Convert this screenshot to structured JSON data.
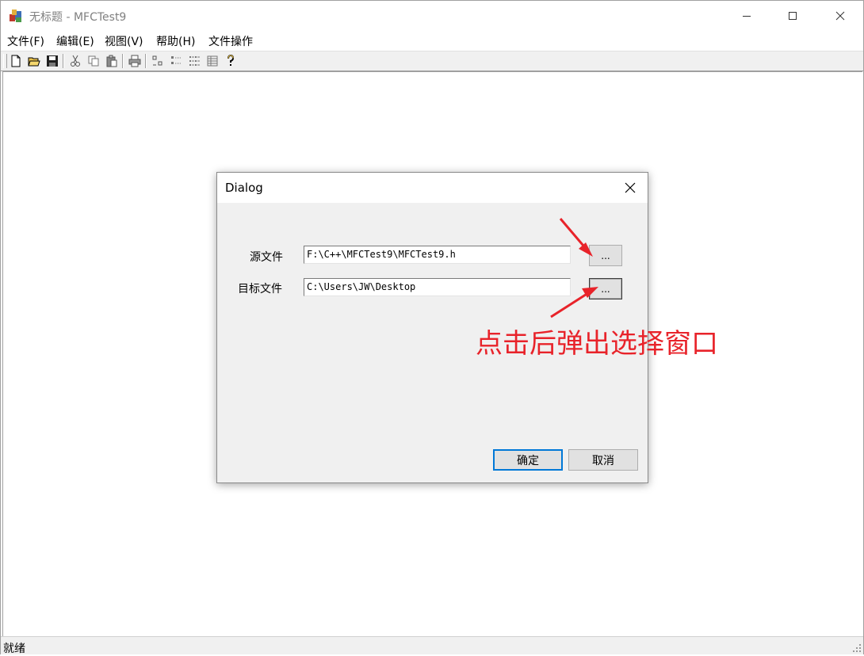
{
  "window": {
    "title": "无标题 - MFCTest9",
    "controls": {
      "minimize": "—",
      "maximize": "☐",
      "close": "✕"
    }
  },
  "menubar": {
    "items": [
      "文件(F)",
      "编辑(E)",
      "视图(V)",
      "帮助(H)",
      "文件操作"
    ]
  },
  "toolbar": {
    "icons": [
      "new-icon",
      "open-icon",
      "save-icon",
      "cut-icon",
      "copy-icon",
      "paste-icon",
      "print-icon",
      "large-icons-view-icon",
      "small-icons-view-icon",
      "list-view-icon",
      "details-view-icon",
      "help-icon"
    ]
  },
  "statusbar": {
    "text": "就绪"
  },
  "dialog": {
    "title": "Dialog",
    "source_label": "源文件",
    "source_value": "F:\\C++\\MFCTest9\\MFCTest9.h",
    "target_label": "目标文件",
    "target_value": "C:\\Users\\JW\\Desktop",
    "browse_label": "...",
    "ok_label": "确定",
    "cancel_label": "取消"
  },
  "annotation": {
    "text": "点击后弹出选择窗口",
    "color": "#e8232a"
  }
}
